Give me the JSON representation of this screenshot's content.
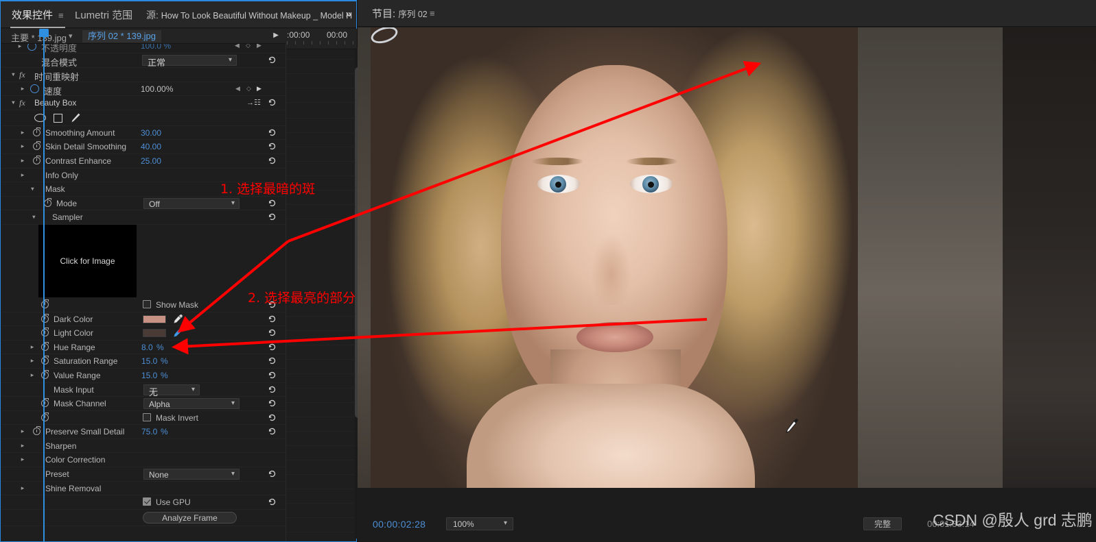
{
  "panel": {
    "tabs": [
      {
        "id": "effect-controls",
        "label": "效果控件",
        "active": true
      },
      {
        "id": "lumetri-scopes",
        "label": "Lumetri 范围",
        "active": false
      }
    ],
    "source_tab": {
      "prefix": "源",
      "name": "How To Look Beautiful Without Makeup _ Model H"
    },
    "overflow": "»",
    "clip_selector": {
      "main": "主要 * 139.jpg",
      "sequence": "序列 02 * 139.jpg"
    },
    "ruler": {
      "left_time": ":00:00",
      "right_time": "00:00"
    }
  },
  "properties": [
    {
      "name": "opacity-partial",
      "label": "不透明度",
      "value": "100.0 %"
    },
    {
      "name": "blend-mode",
      "label": "混合模式",
      "value": "正常"
    },
    {
      "name": "time-remapping",
      "label": "时间重映射"
    },
    {
      "name": "speed",
      "label": "速度",
      "value": "100.00%"
    },
    {
      "name": "beauty-box",
      "label": "Beauty Box"
    },
    {
      "name": "smoothing-amount",
      "label": "Smoothing Amount",
      "value": "30.00"
    },
    {
      "name": "skin-detail-smoothing",
      "label": "Skin Detail Smoothing",
      "value": "40.00"
    },
    {
      "name": "contrast-enhance",
      "label": "Contrast Enhance",
      "value": "25.00"
    },
    {
      "name": "info-only",
      "label": "Info Only"
    },
    {
      "name": "mask",
      "label": "Mask"
    },
    {
      "name": "mode",
      "label": "Mode",
      "value": "Off"
    },
    {
      "name": "sampler",
      "label": "Sampler"
    },
    {
      "name": "sampler-image",
      "label": "Click for Image"
    },
    {
      "name": "show-mask",
      "label": "Show Mask",
      "checked": false
    },
    {
      "name": "dark-color",
      "label": "Dark Color",
      "color": "#c79283"
    },
    {
      "name": "light-color",
      "label": "Light Color",
      "color": "#4a3b36"
    },
    {
      "name": "hue-range",
      "label": "Hue Range",
      "value": "8.0",
      "unit": "%"
    },
    {
      "name": "saturation-range",
      "label": "Saturation Range",
      "value": "15.0",
      "unit": "%"
    },
    {
      "name": "value-range",
      "label": "Value Range",
      "value": "15.0",
      "unit": "%"
    },
    {
      "name": "mask-input",
      "label": "Mask Input",
      "value": "无"
    },
    {
      "name": "mask-channel",
      "label": "Mask Channel",
      "value": "Alpha"
    },
    {
      "name": "mask-invert",
      "label": "Mask Invert",
      "checked": false
    },
    {
      "name": "preserve-small-detail",
      "label": "Preserve Small Detail",
      "value": "75.0",
      "unit": "%"
    },
    {
      "name": "sharpen",
      "label": "Sharpen"
    },
    {
      "name": "color-correction",
      "label": "Color Correction"
    },
    {
      "name": "preset",
      "label": "Preset",
      "value": "None"
    },
    {
      "name": "shine-removal",
      "label": "Shine Removal"
    },
    {
      "name": "use-gpu",
      "label": "Use GPU",
      "checked": true
    },
    {
      "name": "analyze-frame",
      "label": "Analyze Frame"
    }
  ],
  "program_monitor": {
    "tab_prefix": "节目",
    "tab_name": "序列 02",
    "timecode": "00:00:02:28",
    "zoom_level": "100%",
    "fit_label": "完整",
    "duration": "00:01:33:14",
    "watermark": "CSDN @殷人 grd 志鹏"
  },
  "annotations": [
    {
      "name": "annotation-step-1",
      "text": "1. 选择最暗的斑"
    },
    {
      "name": "annotation-step-2",
      "text": "2. 选择最亮的部分"
    }
  ],
  "colors": {
    "accent_blue": "#2f8fe0",
    "value_blue": "#4d8fd6",
    "annotation_red": "#ff0000",
    "panel_bg": "#1e1e1e",
    "tabbar_bg": "#272727"
  }
}
